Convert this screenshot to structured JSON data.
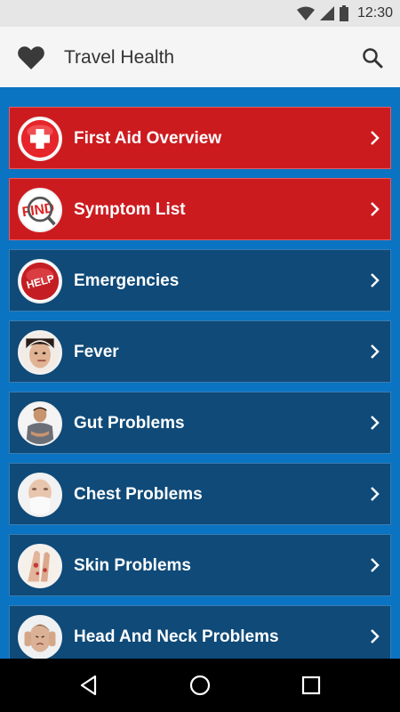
{
  "status_bar": {
    "time": "12:30",
    "icons": [
      "wifi-icon",
      "signal-icon",
      "battery-icon"
    ]
  },
  "app_bar": {
    "title": "Travel Health",
    "logo_icon": "heart-icon",
    "search_icon": "search-icon"
  },
  "menu": {
    "items": [
      {
        "label": "First Aid Overview",
        "icon": "first-aid-icon",
        "style": "red"
      },
      {
        "label": "Symptom List",
        "icon": "find-magnifier-icon",
        "style": "red"
      },
      {
        "label": "Emergencies",
        "icon": "help-button-icon",
        "style": "blue"
      },
      {
        "label": "Fever",
        "icon": "fever-photo-icon",
        "style": "blue"
      },
      {
        "label": "Gut Problems",
        "icon": "gut-photo-icon",
        "style": "blue"
      },
      {
        "label": "Chest Problems",
        "icon": "chest-photo-icon",
        "style": "blue"
      },
      {
        "label": "Skin Problems",
        "icon": "skin-photo-icon",
        "style": "blue"
      },
      {
        "label": "Head And Neck Problems",
        "icon": "head-photo-icon",
        "style": "blue"
      }
    ]
  },
  "nav_bar": {
    "buttons": [
      "back-icon",
      "home-icon",
      "recents-icon"
    ]
  },
  "colors": {
    "accent_blue": "#0a74c2",
    "item_red": "#cc1b1f",
    "item_blue": "#0f4a78",
    "app_bar_bg": "#f5f5f5"
  }
}
